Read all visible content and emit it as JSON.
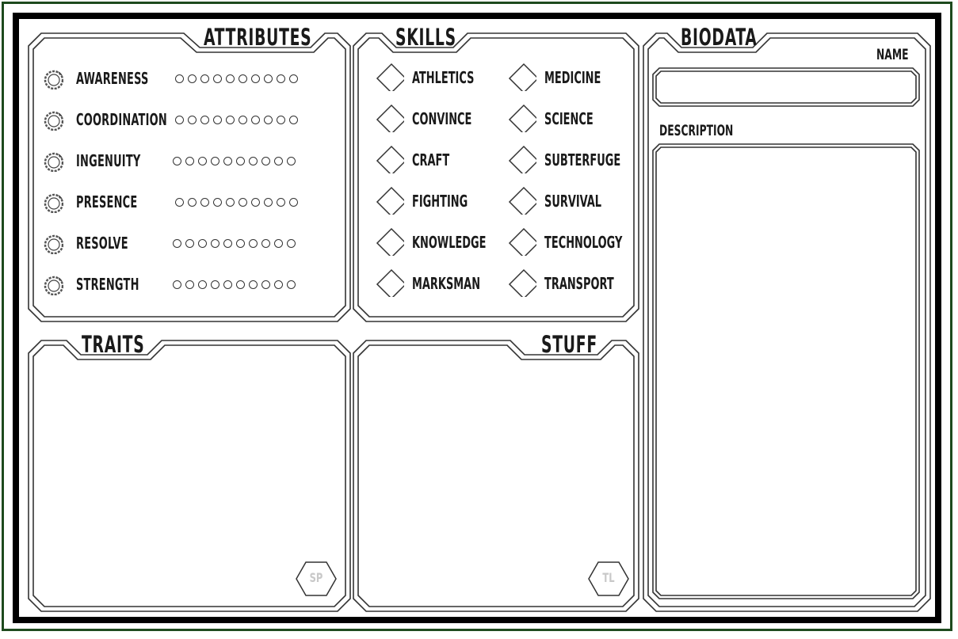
{
  "sections": {
    "attributes": "ATTRIBUTES",
    "skills": "SKILLS",
    "biodata": "BIODATA",
    "traits": "TRAITS",
    "stuff": "STUFF"
  },
  "attributes": [
    {
      "label": "AWARENESS",
      "dots": 10
    },
    {
      "label": "COORDINATION",
      "dots": 10
    },
    {
      "label": "INGENUITY",
      "dots": 10
    },
    {
      "label": "PRESENCE",
      "dots": 10
    },
    {
      "label": "RESOLVE",
      "dots": 10
    },
    {
      "label": "STRENGTH",
      "dots": 10
    }
  ],
  "skills": {
    "left": [
      "ATHLETICS",
      "CONVINCE",
      "CRAFT",
      "FIGHTING",
      "KNOWLEDGE",
      "MARKSMAN"
    ],
    "right": [
      "MEDICINE",
      "SCIENCE",
      "SUBTERFUGE",
      "SURVIVAL",
      "TECHNOLOGY",
      "TRANSPORT"
    ]
  },
  "biodata": {
    "name_label": "NAME",
    "description_label": "DESCRIPTION"
  },
  "badges": {
    "traits": "SP",
    "stuff": "TL"
  },
  "colors": {
    "frame_green": "#1e4a1e",
    "ink": "#1a1a1a",
    "badge_text": "#c8c8c8"
  }
}
